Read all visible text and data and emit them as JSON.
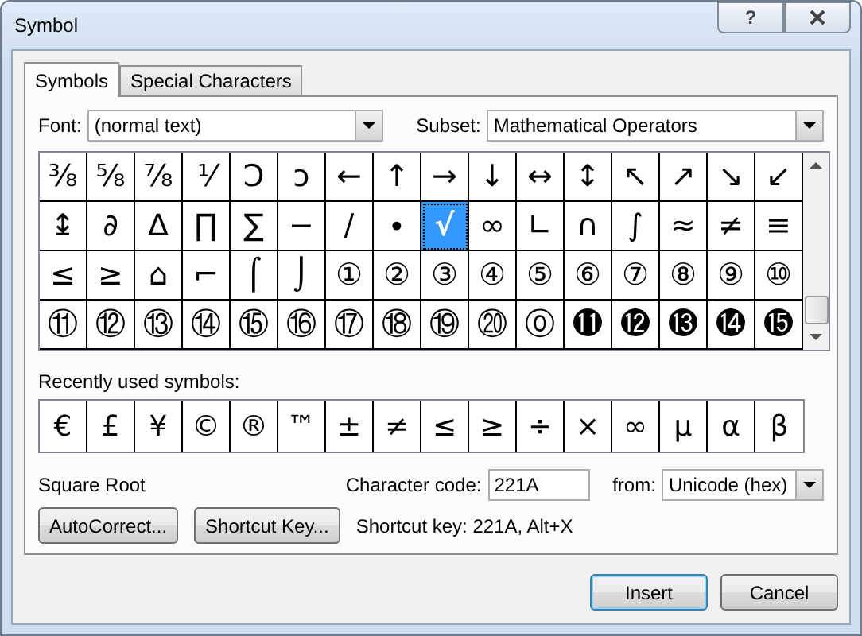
{
  "window": {
    "title": "Symbol",
    "help": "?"
  },
  "tabs": [
    {
      "label": "Symbols",
      "selected": true
    },
    {
      "label": "Special Characters",
      "selected": false
    }
  ],
  "font": {
    "label": "Font:",
    "value": "(normal text)"
  },
  "subset": {
    "label": "Subset:",
    "value": "Mathematical Operators"
  },
  "grid": [
    [
      {
        "char": "⅜",
        "selected": false
      },
      {
        "char": "⅝",
        "selected": false
      },
      {
        "char": "⅞",
        "selected": false
      },
      {
        "char": "⅟",
        "selected": false
      },
      {
        "char": "Ↄ",
        "selected": false
      },
      {
        "char": "ↄ",
        "selected": false
      },
      {
        "char": "←",
        "selected": false
      },
      {
        "char": "↑",
        "selected": false
      },
      {
        "char": "→",
        "selected": false
      },
      {
        "char": "↓",
        "selected": false
      },
      {
        "char": "↔",
        "selected": false
      },
      {
        "char": "↕",
        "selected": false
      },
      {
        "char": "↖",
        "selected": false
      },
      {
        "char": "↗",
        "selected": false
      },
      {
        "char": "↘",
        "selected": false
      },
      {
        "char": "↙",
        "selected": false
      }
    ],
    [
      {
        "char": "↨",
        "selected": false
      },
      {
        "char": "∂",
        "selected": false
      },
      {
        "char": "∆",
        "selected": false
      },
      {
        "char": "∏",
        "selected": false
      },
      {
        "char": "∑",
        "selected": false
      },
      {
        "char": "−",
        "selected": false
      },
      {
        "char": "∕",
        "selected": false
      },
      {
        "char": "∙",
        "selected": false
      },
      {
        "char": "√",
        "selected": true
      },
      {
        "char": "∞",
        "selected": false
      },
      {
        "char": "∟",
        "selected": false
      },
      {
        "char": "∩",
        "selected": false
      },
      {
        "char": "∫",
        "selected": false
      },
      {
        "char": "≈",
        "selected": false
      },
      {
        "char": "≠",
        "selected": false
      },
      {
        "char": "≡",
        "selected": false
      }
    ],
    [
      {
        "char": "≤",
        "selected": false
      },
      {
        "char": "≥",
        "selected": false
      },
      {
        "char": "⌂",
        "selected": false
      },
      {
        "char": "⌐",
        "selected": false
      },
      {
        "char": "⌠",
        "selected": false
      },
      {
        "char": "⌡",
        "selected": false
      },
      {
        "char": "①",
        "selected": false
      },
      {
        "char": "②",
        "selected": false
      },
      {
        "char": "③",
        "selected": false
      },
      {
        "char": "④",
        "selected": false
      },
      {
        "char": "⑤",
        "selected": false
      },
      {
        "char": "⑥",
        "selected": false
      },
      {
        "char": "⑦",
        "selected": false
      },
      {
        "char": "⑧",
        "selected": false
      },
      {
        "char": "⑨",
        "selected": false
      },
      {
        "char": "⑩",
        "selected": false
      }
    ],
    [
      {
        "char": "⑪",
        "selected": false
      },
      {
        "char": "⑫",
        "selected": false
      },
      {
        "char": "⑬",
        "selected": false
      },
      {
        "char": "⑭",
        "selected": false
      },
      {
        "char": "⑮",
        "selected": false
      },
      {
        "char": "⑯",
        "selected": false
      },
      {
        "char": "⑰",
        "selected": false
      },
      {
        "char": "⑱",
        "selected": false
      },
      {
        "char": "⑲",
        "selected": false
      },
      {
        "char": "⑳",
        "selected": false
      },
      {
        "char": "⓪",
        "selected": false
      },
      {
        "char": "⓫",
        "selected": false
      },
      {
        "char": "⓬",
        "selected": false
      },
      {
        "char": "⓭",
        "selected": false
      },
      {
        "char": "⓮",
        "selected": false
      },
      {
        "char": "⓯",
        "selected": false
      }
    ]
  ],
  "recent": {
    "label": "Recently used symbols:",
    "symbols": [
      "€",
      "£",
      "¥",
      "©",
      "®",
      "™",
      "±",
      "≠",
      "≤",
      "≥",
      "÷",
      "×",
      "∞",
      "µ",
      "α",
      "β"
    ]
  },
  "character_name": "Square Root",
  "character_code": {
    "label": "Character code:",
    "value": "221A"
  },
  "from": {
    "label": "from:",
    "value": "Unicode (hex)"
  },
  "autocorrect_button": "AutoCorrect...",
  "shortcut_key_button": "Shortcut Key...",
  "shortcut_text": "Shortcut key: 221A, Alt+X",
  "buttons": [
    {
      "label": "Insert",
      "kind": "default"
    },
    {
      "label": "Cancel",
      "kind": "normal"
    }
  ]
}
